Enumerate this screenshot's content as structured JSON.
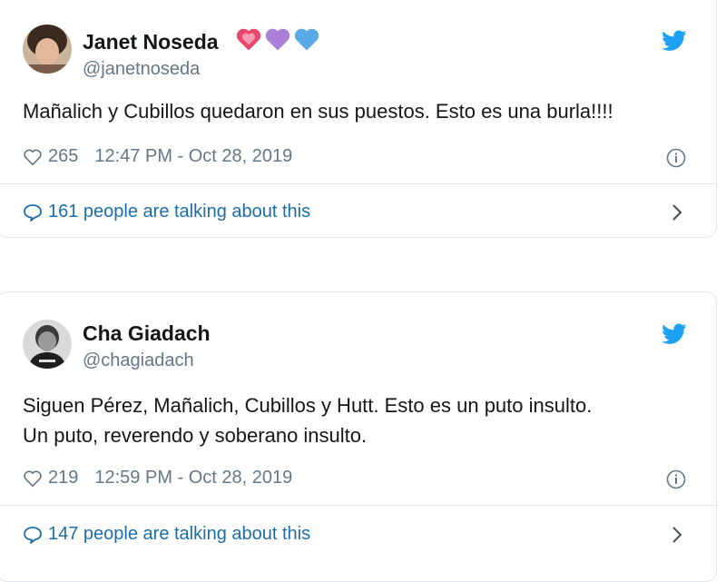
{
  "tweets": [
    {
      "name": "Janet Noseda",
      "name_emojis": [
        "pink-heart-emoji",
        "purple-heart-emoji",
        "blue-heart-emoji"
      ],
      "handle": "@janetnoseda",
      "text_lines": [
        "Mañalich y Cubillos quedaron en sus puestos. Esto es una burla!!!!"
      ],
      "likes": "265",
      "timestamp": "12:47 PM - Oct 28, 2019",
      "talking": "161 people are talking about this"
    },
    {
      "name": "Cha Giadach",
      "handle": "@chagiadach",
      "text_lines": [
        "Siguen Pérez, Mañalich, Cubillos y Hutt. Esto es un puto insulto.",
        "Un puto, reverendo y soberano insulto."
      ],
      "likes": "219",
      "timestamp": "12:59 PM - Oct 28, 2019",
      "talking": "147 people are talking about this"
    }
  ],
  "colors": {
    "twitter_blue": "#1da1f2",
    "link_blue": "#1b6ea8",
    "secondary_text": "#657786",
    "border": "#e1e8ed"
  },
  "icons": [
    "twitter-logo-icon",
    "heart-icon",
    "info-icon",
    "comment-bubble-icon",
    "chevron-right-icon"
  ]
}
